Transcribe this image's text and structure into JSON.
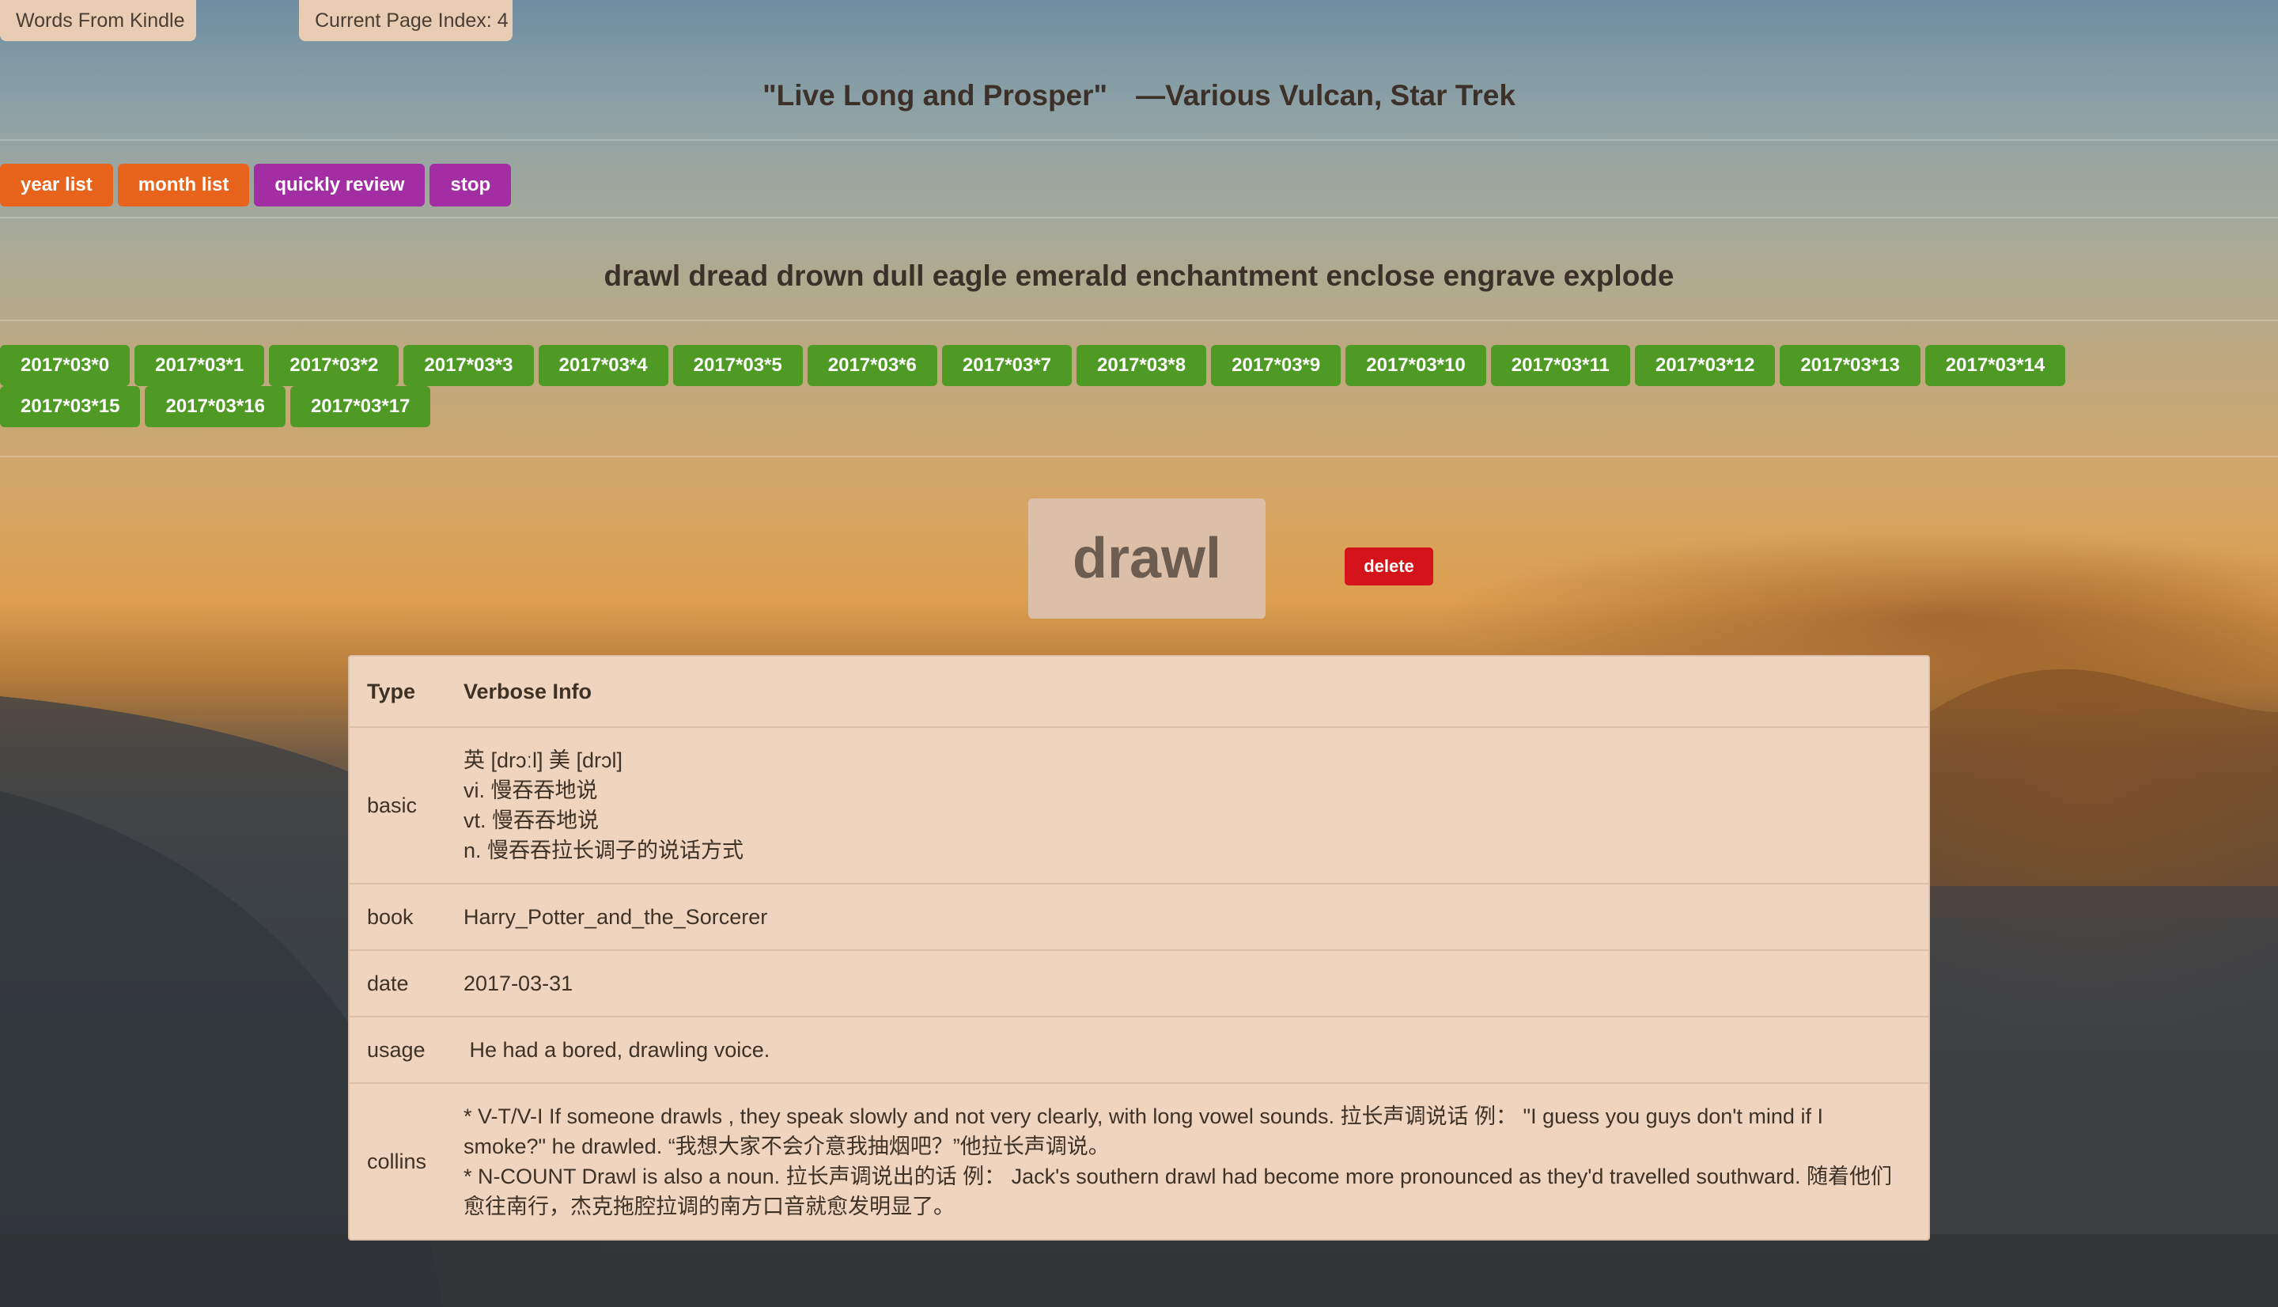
{
  "header": {
    "brand": "Words From Kindle",
    "page_index": "Current Page Index: 4"
  },
  "quote": {
    "text": "\"Live Long and Prosper\"",
    "author": "—Various Vulcan, Star Trek"
  },
  "controls": {
    "year_list": "year list",
    "month_list": "month list",
    "quickly_review": "quickly review",
    "stop": "stop"
  },
  "word_strip": "drawl dread drown dull eagle emerald enchantment enclose engrave explode",
  "dates": [
    "2017*03*0",
    "2017*03*1",
    "2017*03*2",
    "2017*03*3",
    "2017*03*4",
    "2017*03*5",
    "2017*03*6",
    "2017*03*7",
    "2017*03*8",
    "2017*03*9",
    "2017*03*10",
    "2017*03*11",
    "2017*03*12",
    "2017*03*13",
    "2017*03*14",
    "2017*03*15",
    "2017*03*16",
    "2017*03*17"
  ],
  "current_word": "drawl",
  "delete_label": "delete",
  "table": {
    "headers": {
      "type": "Type",
      "info": "Verbose Info"
    },
    "rows": {
      "basic": {
        "type": "basic",
        "lines": [
          "英 [drɔːl] 美 [drɔl]",
          "vi. 慢吞吞地说",
          "vt. 慢吞吞地说",
          "n. 慢吞吞拉长调子的说话方式"
        ]
      },
      "book": {
        "type": "book",
        "value": "Harry_Potter_and_the_Sorcerer"
      },
      "date": {
        "type": "date",
        "value": "2017-03-31"
      },
      "usage": {
        "type": "usage",
        "value": " He had a bored, drawling voice."
      },
      "collins": {
        "type": "collins",
        "lines": [
          "* V-T/V-I If someone drawls , they speak slowly and not very clearly, with long vowel sounds. 拉长声调说话 例：  \"I guess you guys don't mind if I smoke?\" he drawled. “我想大家不会介意我抽烟吧？”他拉长声调说。",
          "* N-COUNT Drawl is also a noun. 拉长声调说出的话 例：  Jack's southern drawl had become more pronounced as they'd travelled southward. 随着他们愈往南行，杰克拖腔拉调的南方口音就愈发明显了。"
        ]
      }
    }
  }
}
